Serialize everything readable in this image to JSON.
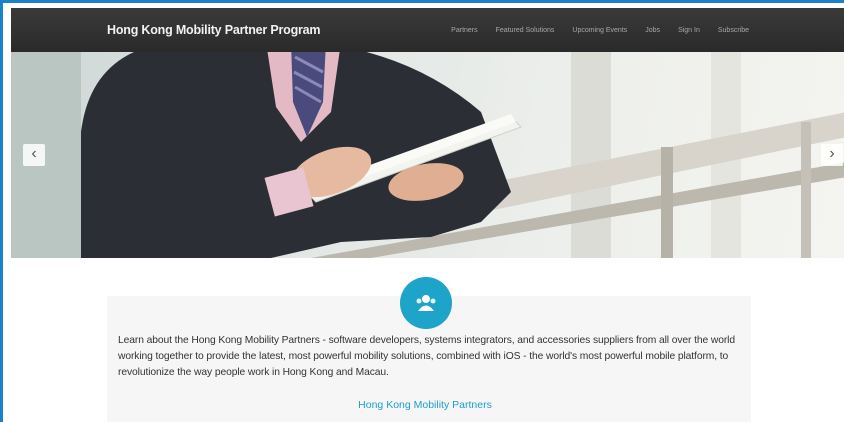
{
  "navbar": {
    "brand": "Hong Kong Mobility Partner Program",
    "links": [
      "Partners",
      "Featured Solutions",
      "Upcoming Events",
      "Jobs",
      "Sign In",
      "Subscribe"
    ]
  },
  "carousel": {
    "prev_label": "‹",
    "next_label": "›"
  },
  "intro": {
    "icon": "group-icon",
    "text": "Learn about the Hong Kong Mobility Partners - software developers, systems integrators, and accessories suppliers from all over the world working together to provide the latest, most powerful mobility solutions, combined with iOS - the world's most powerful mobile platform, to revolutionize the way people work in Hong Kong and Macau.",
    "link": "Hong Kong Mobility Partners"
  },
  "colors": {
    "accent": "#1da4c8",
    "navbar": "#2f2f2f",
    "frame": "#1a82c8"
  }
}
